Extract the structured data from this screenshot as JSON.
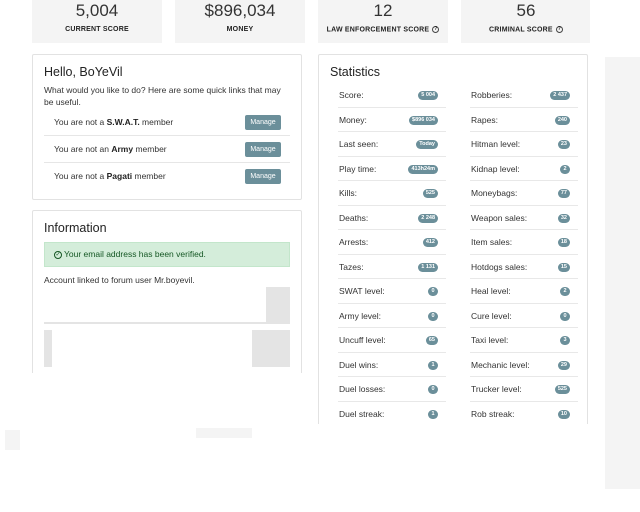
{
  "top_stats": [
    {
      "value": "5,004",
      "label": "CURRENT SCORE",
      "help": false
    },
    {
      "value": "$896,034",
      "label": "MONEY",
      "help": false
    },
    {
      "value": "12",
      "label": "LAW ENFORCEMENT SCORE",
      "help": true
    },
    {
      "value": "56",
      "label": "CRIMINAL SCORE",
      "help": true
    }
  ],
  "greeting": {
    "title": "Hello, BoYeVil",
    "intro": "What would you like to do? Here are some quick links that may be useful.",
    "manage_label": "Manage",
    "memberships": [
      {
        "prefix": "You are not a ",
        "group": "S.W.A.T.",
        "suffix": " member"
      },
      {
        "prefix": "You are not an ",
        "group": "Army",
        "suffix": " member"
      },
      {
        "prefix": "You are not a ",
        "group": "Pagati",
        "suffix": " member"
      }
    ]
  },
  "information": {
    "title": "Information",
    "verified_text": "Your email address has been verified.",
    "forum_link_text": "Account linked to forum user Mr.boyevil."
  },
  "statistics": {
    "title": "Statistics",
    "left": [
      {
        "label": "Score:",
        "value": "5 004"
      },
      {
        "label": "Money:",
        "value": "$896 034"
      },
      {
        "label": "Last seen:",
        "value": "Today"
      },
      {
        "label": "Play time:",
        "value": "413h24m"
      },
      {
        "label": "Kills:",
        "value": "525"
      },
      {
        "label": "Deaths:",
        "value": "2 248"
      },
      {
        "label": "Arrests:",
        "value": "412"
      },
      {
        "label": "Tazes:",
        "value": "1 131"
      },
      {
        "label": "SWAT level:",
        "value": "0"
      },
      {
        "label": "Army level:",
        "value": "0"
      },
      {
        "label": "Uncuff level:",
        "value": "65"
      },
      {
        "label": "Duel wins:",
        "value": "1"
      },
      {
        "label": "Duel losses:",
        "value": "0"
      },
      {
        "label": "Duel streak:",
        "value": "1"
      }
    ],
    "right": [
      {
        "label": "Robberies:",
        "value": "2 437"
      },
      {
        "label": "Rapes:",
        "value": "240"
      },
      {
        "label": "Hitman level:",
        "value": "23"
      },
      {
        "label": "Kidnap level:",
        "value": "2"
      },
      {
        "label": "Moneybags:",
        "value": "77"
      },
      {
        "label": "Weapon sales:",
        "value": "32"
      },
      {
        "label": "Item sales:",
        "value": "18"
      },
      {
        "label": "Hotdogs sales:",
        "value": "15"
      },
      {
        "label": "Heal level:",
        "value": "2"
      },
      {
        "label": "Cure level:",
        "value": "0"
      },
      {
        "label": "Taxi level:",
        "value": "3"
      },
      {
        "label": "Mechanic level:",
        "value": "29"
      },
      {
        "label": "Trucker level:",
        "value": "525"
      },
      {
        "label": "Rob streak:",
        "value": "10"
      }
    ]
  },
  "colors": {
    "badge": "#6b8f9a",
    "verified_bg": "#d4edda",
    "verified_text": "#155724"
  }
}
